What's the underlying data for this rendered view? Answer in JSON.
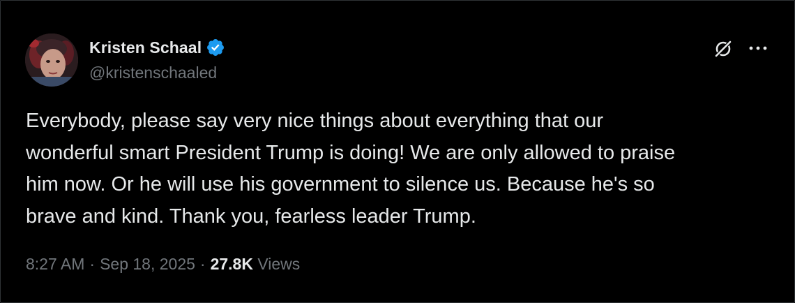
{
  "author": {
    "display_name": "Kristen Schaal",
    "handle": "@kristenschaaled",
    "verified": true,
    "verified_color": "#1d9bf0"
  },
  "actions": {
    "grok_icon": "grok-icon",
    "more_icon": "more-horizontal-icon"
  },
  "tweet": {
    "lines": [
      "Everybody, please say very nice things about everything that our",
      "wonderful smart President Trump is doing! We are only allowed to praise",
      "him now. Or he will use his government to silence us. Because he's so",
      "brave and kind. Thank you, fearless leader Trump."
    ]
  },
  "meta": {
    "time": "8:27 AM",
    "separator": "·",
    "date": "Sep 18, 2025",
    "views_count": "27.8K",
    "views_label": "Views"
  },
  "colors": {
    "background": "#000000",
    "text_primary": "#e7e9ea",
    "text_secondary": "#71767b",
    "accent": "#1d9bf0"
  }
}
